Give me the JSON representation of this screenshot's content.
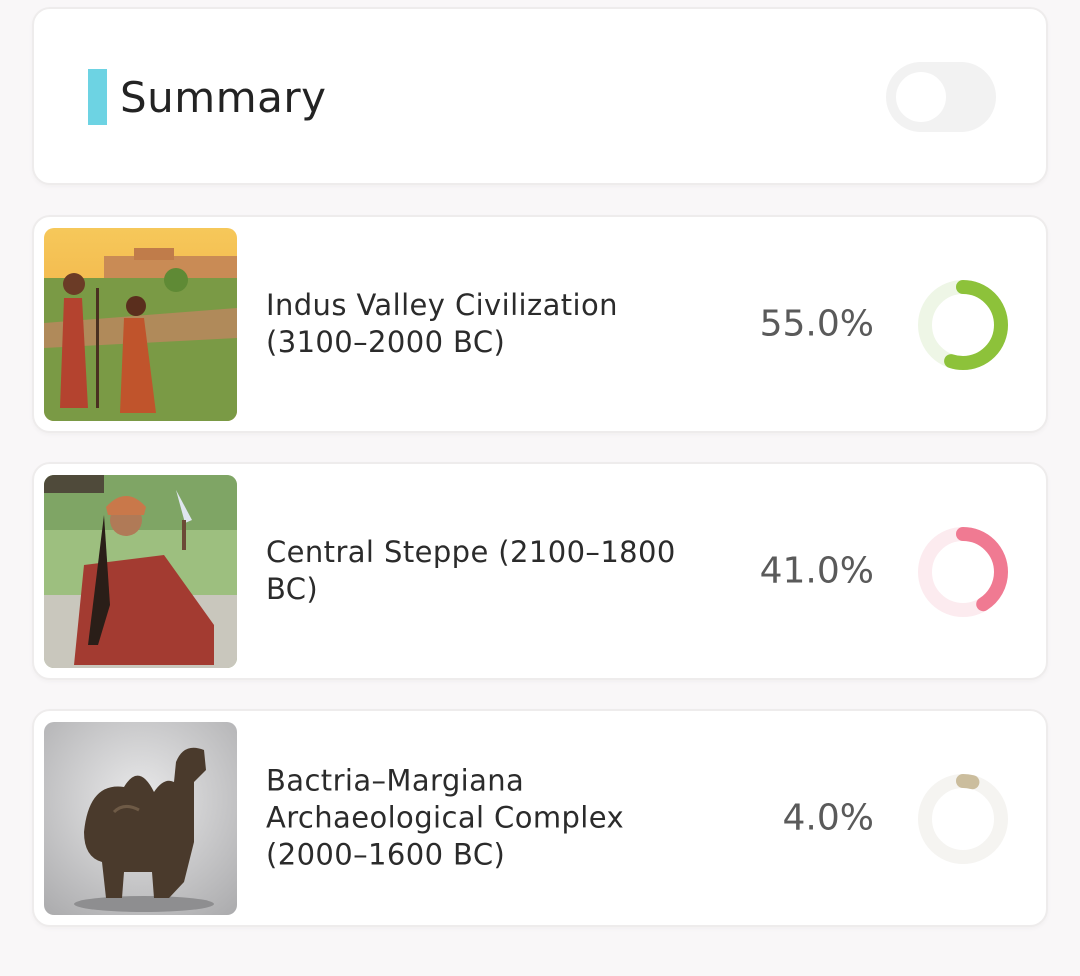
{
  "summary": {
    "title": "Summary",
    "accent_color": "#6dd3e3",
    "toggle_on": false
  },
  "items": [
    {
      "label": "Indus Valley Civilization (3100–2000 BC)",
      "percent_text": "55.0%",
      "percent": 55.0,
      "color": "#8dc23a",
      "track_color": "#eef6e6",
      "image_icon": "indus-valley-illustration"
    },
    {
      "label": "Central Steppe (2100–1800 BC)",
      "percent_text": "41.0%",
      "percent": 41.0,
      "color": "#f07a92",
      "track_color": "#fcebef",
      "image_icon": "steppe-woman-illustration"
    },
    {
      "label": "Bactria–Margiana Archaeological Complex (2000–1600 BC)",
      "percent_text": "4.0%",
      "percent": 4.0,
      "color": "#cbbd9d",
      "track_color": "#f5f4f1",
      "image_icon": "bronze-camel-photo"
    }
  ]
}
